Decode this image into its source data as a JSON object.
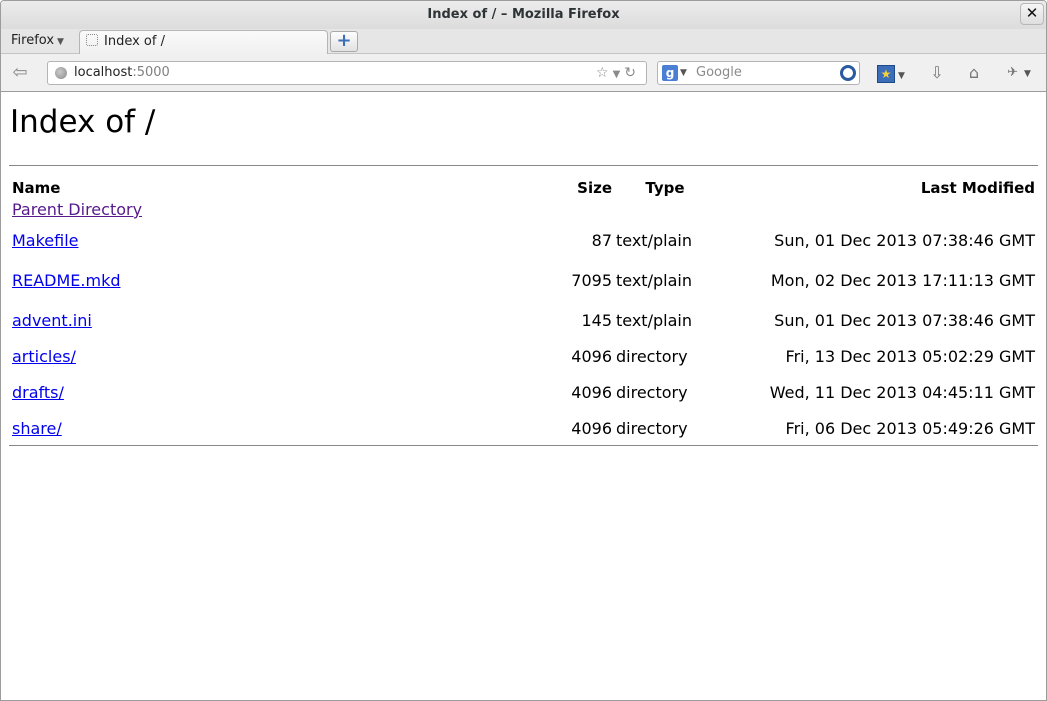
{
  "window": {
    "title": "Index of / – Mozilla Firefox"
  },
  "tabstrip": {
    "menu_label": "Firefox",
    "tab_title": "Index of /"
  },
  "navbar": {
    "url_host": "localhost",
    "url_port": ":5000",
    "search_placeholder": "Google"
  },
  "page": {
    "heading": "Index of /",
    "columns": {
      "name": "Name",
      "size": "Size",
      "type": "Type",
      "modified": "Last Modified"
    },
    "parent_link": "Parent Directory",
    "rows": [
      {
        "name": "Makefile",
        "size": "87",
        "type": "text/plain",
        "modified": "Sun, 01 Dec 2013 07:38:46 GMT"
      },
      {
        "name": "README.mkd",
        "size": "7095",
        "type": "text/plain",
        "modified": "Mon, 02 Dec 2013 17:11:13 GMT"
      },
      {
        "name": "advent.ini",
        "size": "145",
        "type": "text/plain",
        "modified": "Sun, 01 Dec 2013 07:38:46 GMT"
      },
      {
        "name": "articles/",
        "size": "4096",
        "type": "directory",
        "modified": "Fri, 13 Dec 2013 05:02:29 GMT"
      },
      {
        "name": "drafts/",
        "size": "4096",
        "type": "directory",
        "modified": "Wed, 11 Dec 2013 04:45:11 GMT"
      },
      {
        "name": "share/",
        "size": "4096",
        "type": "directory",
        "modified": "Fri, 06 Dec 2013 05:49:26 GMT"
      }
    ]
  },
  "colors": {
    "link": "#0000ee",
    "visited_link": "#551a8b",
    "rule": "#888888"
  }
}
